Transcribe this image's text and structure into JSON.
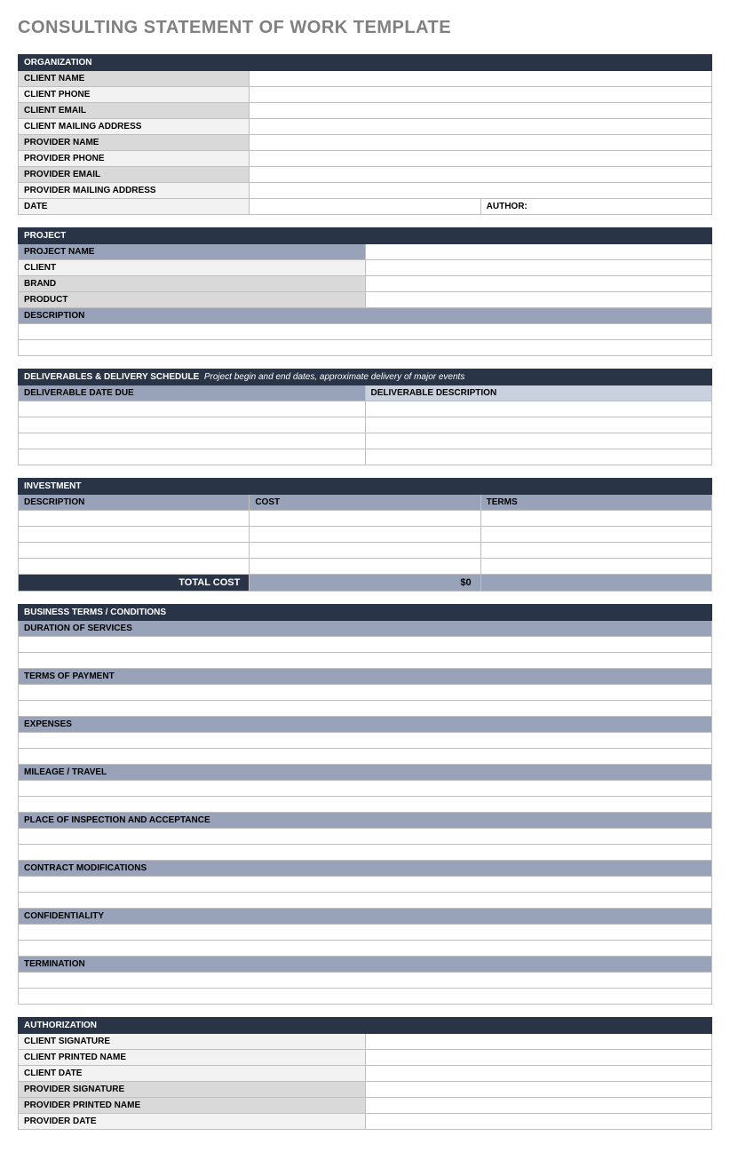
{
  "title": "CONSULTING STATEMENT OF WORK TEMPLATE",
  "organization": {
    "header": "ORGANIZATION",
    "rows": [
      {
        "label": "CLIENT NAME",
        "shade": "lbl-gray1"
      },
      {
        "label": "CLIENT  PHONE",
        "shade": "lbl-gray2"
      },
      {
        "label": "CLIENT EMAIL",
        "shade": "lbl-gray1"
      },
      {
        "label": "CLIENT MAILING ADDRESS",
        "shade": "lbl-gray2"
      },
      {
        "label": "PROVIDER NAME",
        "shade": "lbl-gray1"
      },
      {
        "label": "PROVIDER PHONE",
        "shade": "lbl-gray2"
      },
      {
        "label": "PROVIDER EMAIL",
        "shade": "lbl-gray1"
      },
      {
        "label": "PROVIDER MAILING ADDRESS",
        "shade": "lbl-gray2"
      }
    ],
    "date_label": "DATE",
    "author_label": "AUTHOR:"
  },
  "project": {
    "header": "PROJECT",
    "rows": [
      {
        "label": "PROJECT NAME",
        "shade": "subhdr-blue"
      },
      {
        "label": "CLIENT",
        "shade": "lbl-gray2"
      },
      {
        "label": "BRAND",
        "shade": "lbl-gray1"
      },
      {
        "label": "PRODUCT",
        "shade": "lbl-gray1"
      }
    ],
    "description_label": "DESCRIPTION"
  },
  "deliverables": {
    "header": "DELIVERABLES & DELIVERY SCHEDULE",
    "header_note": "Project begin and end dates, approximate delivery of major events",
    "col1": "DELIVERABLE DATE DUE",
    "col2": "DELIVERABLE DESCRIPTION"
  },
  "investment": {
    "header": "INVESTMENT",
    "col1": "DESCRIPTION",
    "col2": "COST",
    "col3": "TERMS",
    "total_label": "TOTAL COST",
    "total_value": "$0"
  },
  "terms": {
    "header": "BUSINESS TERMS / CONDITIONS",
    "items": [
      "DURATION OF SERVICES",
      "TERMS OF PAYMENT",
      "EXPENSES",
      "MILEAGE / TRAVEL",
      "PLACE OF INSPECTION AND ACCEPTANCE",
      "CONTRACT MODIFICATIONS",
      "CONFIDENTIALITY",
      "TERMINATION"
    ]
  },
  "authorization": {
    "header": "AUTHORIZATION",
    "rows": [
      {
        "label": "CLIENT SIGNATURE",
        "shade": "lbl-gray2"
      },
      {
        "label": "CLIENT PRINTED NAME",
        "shade": "lbl-gray2"
      },
      {
        "label": "CLIENT DATE",
        "shade": "lbl-gray2"
      },
      {
        "label": "PROVIDER SIGNATURE",
        "shade": "lbl-gray1"
      },
      {
        "label": "PROVIDER PRINTED NAME",
        "shade": "lbl-gray1"
      },
      {
        "label": "PROVIDER DATE",
        "shade": "lbl-gray2"
      }
    ]
  }
}
